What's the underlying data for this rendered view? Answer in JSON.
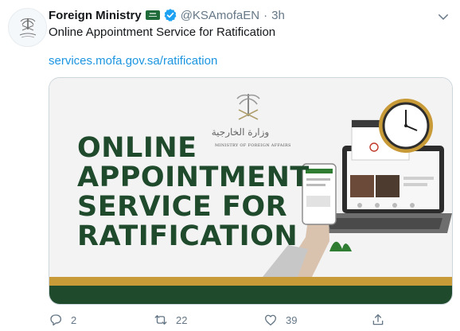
{
  "tweet": {
    "display_name": "Foreign Ministry",
    "handle": "@KSAmofaEN",
    "separator": "·",
    "time": "3h",
    "text": "Online Appointment Service for Ratification",
    "link": "services.mofa.gov.sa/ratification"
  },
  "media": {
    "headline_lines": [
      "ONLINE",
      "APPOINTMENT",
      "SERVICE FOR",
      "RATIFICATION"
    ],
    "ministry_label": "MINISTRY OF FOREIGN AFFAIRS",
    "logo_arabic": "وزارة الخارجية",
    "clock_time": "10:00"
  },
  "actions": {
    "reply_count": "2",
    "retweet_count": "22",
    "like_count": "39"
  },
  "colors": {
    "accent": "#1b95e0",
    "verified": "#1da1f2",
    "headline": "#1f4a2c",
    "gold": "#c89b38",
    "dark_green": "#1f4a2c"
  },
  "icons": [
    "ministry-logo-icon",
    "verified-badge-icon",
    "saudi-flag-icon",
    "chevron-down-icon",
    "reply-icon",
    "retweet-icon",
    "like-icon",
    "share-icon"
  ]
}
